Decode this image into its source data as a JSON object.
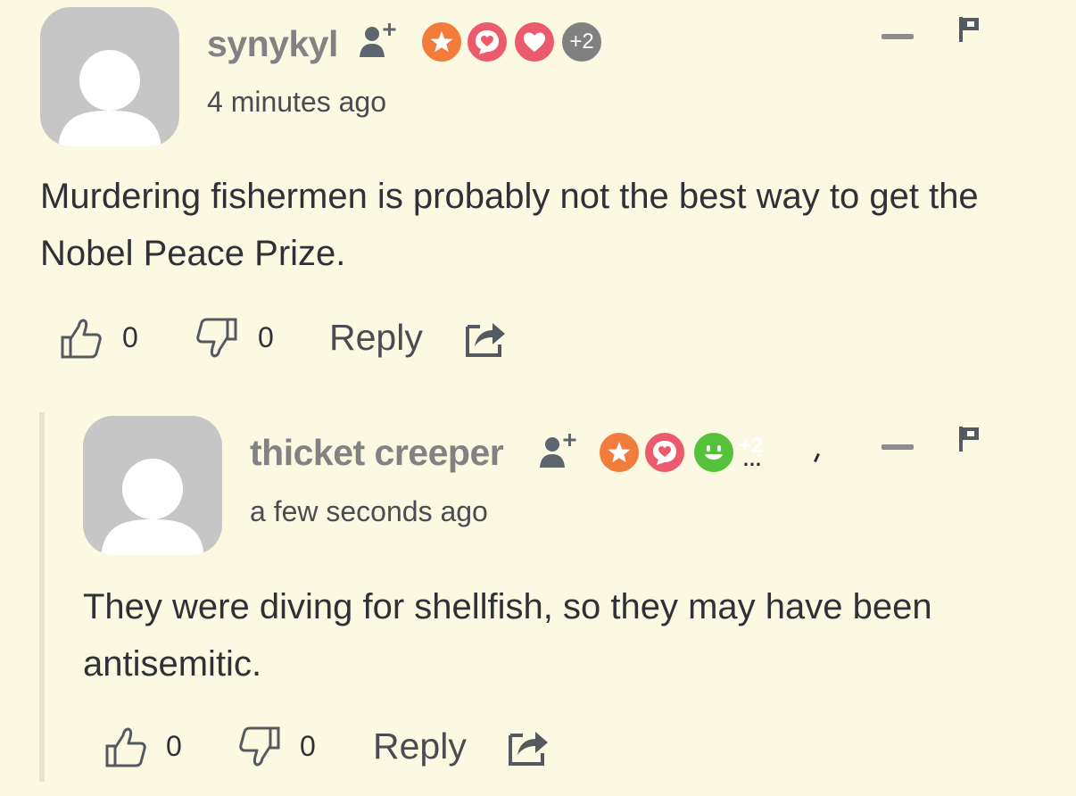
{
  "comments": [
    {
      "username": "synykyl",
      "timestamp": "4 minutes ago",
      "text": "Murdering fishermen is probably not the best way to get the Nobel Peace Prize.",
      "badges": [
        "star-badge",
        "love-message-badge",
        "heart-badge"
      ],
      "extra_badges": "+2",
      "likes": "0",
      "dislikes": "0",
      "reply_label": "Reply"
    },
    {
      "username": "thicket creeper",
      "timestamp": "a few seconds ago",
      "text": "They were diving for shellfish, so they may have been antisemitic.",
      "badges": [
        "star-badge",
        "love-message-badge",
        "smile-badge"
      ],
      "extra_badges": "+2",
      "likes": "0",
      "dislikes": "0",
      "reply_label": "Reply"
    }
  ],
  "colors": {
    "background": "#fbf9e1",
    "username": "#828282",
    "star_badge": "#f27c3c",
    "love_badge": "#ec5a6e",
    "heart_badge": "#ec5a6e",
    "smile_badge": "#56c23b",
    "extra_badge": "#808080"
  }
}
